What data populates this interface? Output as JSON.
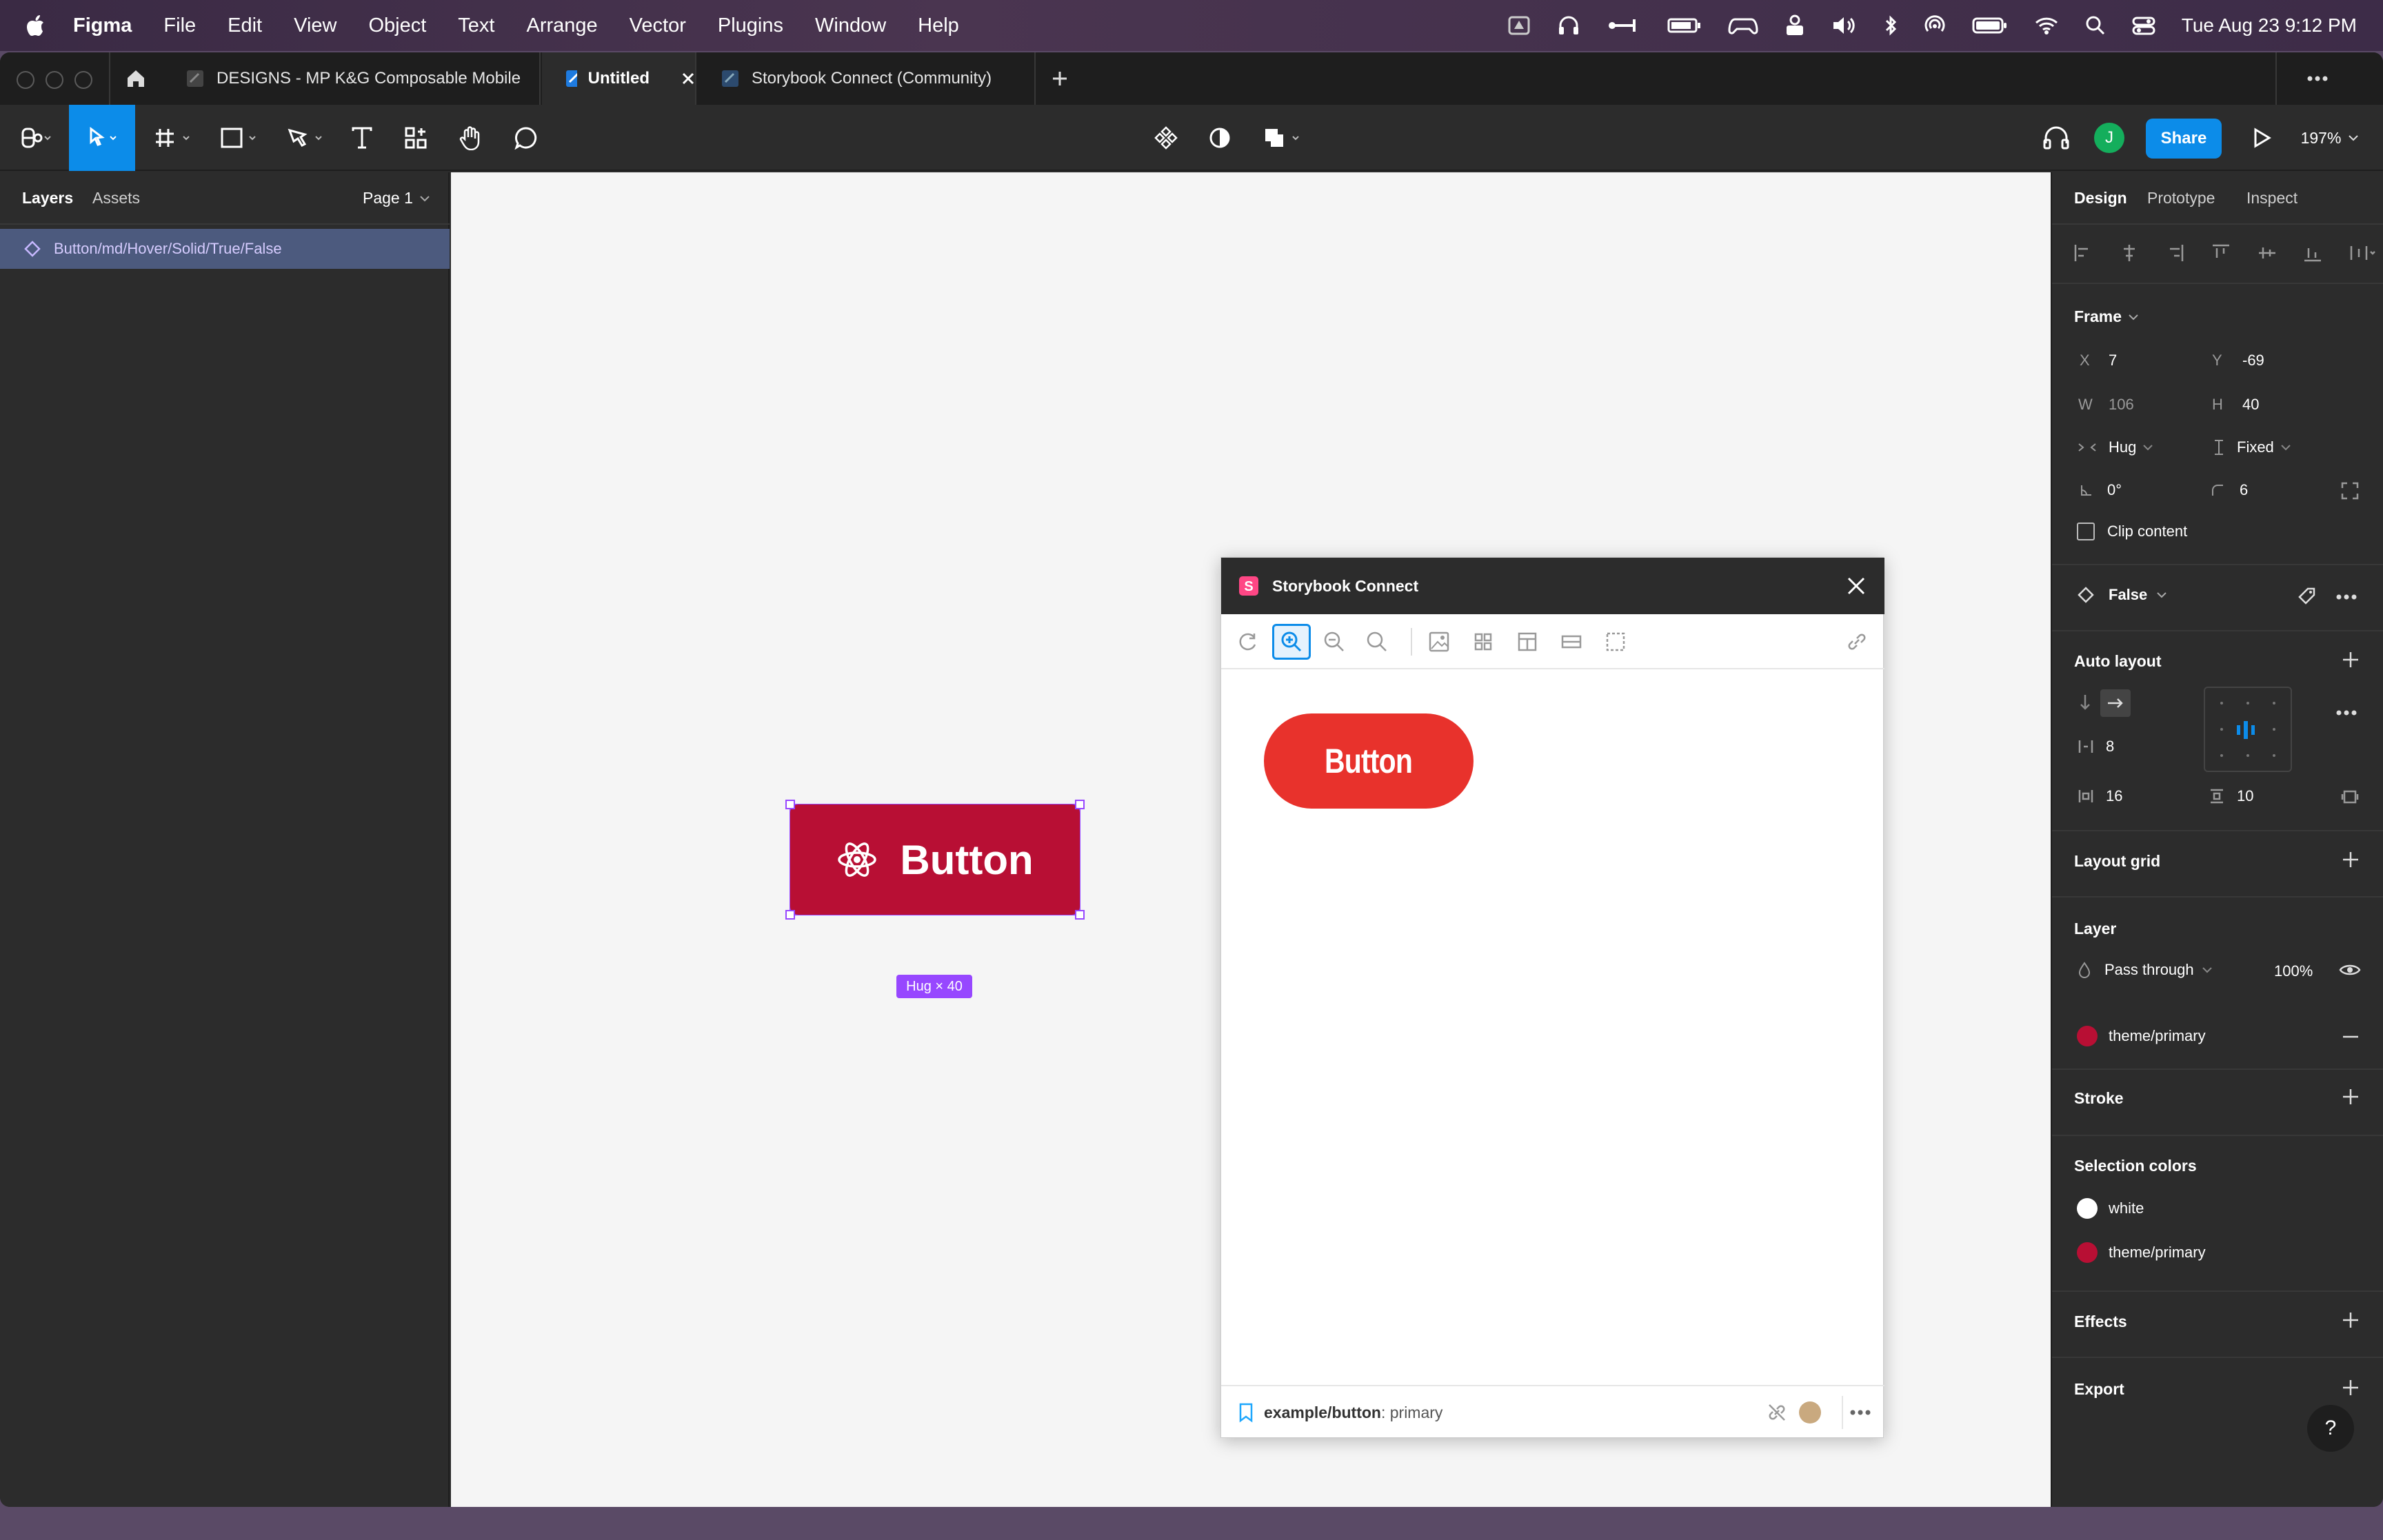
{
  "menubar": {
    "app": "Figma",
    "items": [
      "File",
      "Edit",
      "View",
      "Object",
      "Text",
      "Arrange",
      "Vector",
      "Plugins",
      "Window",
      "Help"
    ],
    "clock": "Tue Aug 23  9:12 PM"
  },
  "tabs": [
    {
      "label": "DESIGNS - MP K&G Composable Mobile"
    },
    {
      "label": "Untitled"
    },
    {
      "label": "Storybook Connect (Community)"
    }
  ],
  "toolbar": {
    "share_label": "Share",
    "zoom": "197%",
    "avatar_initial": "J"
  },
  "left_panel": {
    "tab_layers": "Layers",
    "tab_assets": "Assets",
    "page": "Page 1",
    "layer_name": "Button/md/Hover/Solid/True/False"
  },
  "canvas": {
    "button_label": "Button",
    "size_badge": "Hug × 40",
    "button_color": "#b80f34"
  },
  "plugin": {
    "title": "Storybook Connect",
    "preview_button_label": "Button",
    "preview_button_color": "#e8322c",
    "story_path": "example/button",
    "story_name": ": primary"
  },
  "right_panel": {
    "tabs": [
      "Design",
      "Prototype",
      "Inspect"
    ],
    "frame_label": "Frame",
    "x_label": "X",
    "x_value": "7",
    "y_label": "Y",
    "y_value": "-69",
    "w_label": "W",
    "w_value": "106",
    "h_label": "H",
    "h_value": "40",
    "hug": "Hug",
    "fixed": "Fixed",
    "rotation": "0°",
    "radius": "6",
    "clip_content": "Clip content",
    "variant": "False",
    "auto_layout": "Auto layout",
    "spacing": "8",
    "padding_h": "16",
    "padding_v": "10",
    "layout_grid": "Layout grid",
    "layer": "Layer",
    "blend": "Pass through",
    "opacity": "100%",
    "fill_name": "theme/primary",
    "stroke": "Stroke",
    "selection_colors": "Selection colors",
    "sel_color_1": "white",
    "sel_color_2": "theme/primary",
    "effects": "Effects",
    "export": "Export",
    "help": "?"
  }
}
